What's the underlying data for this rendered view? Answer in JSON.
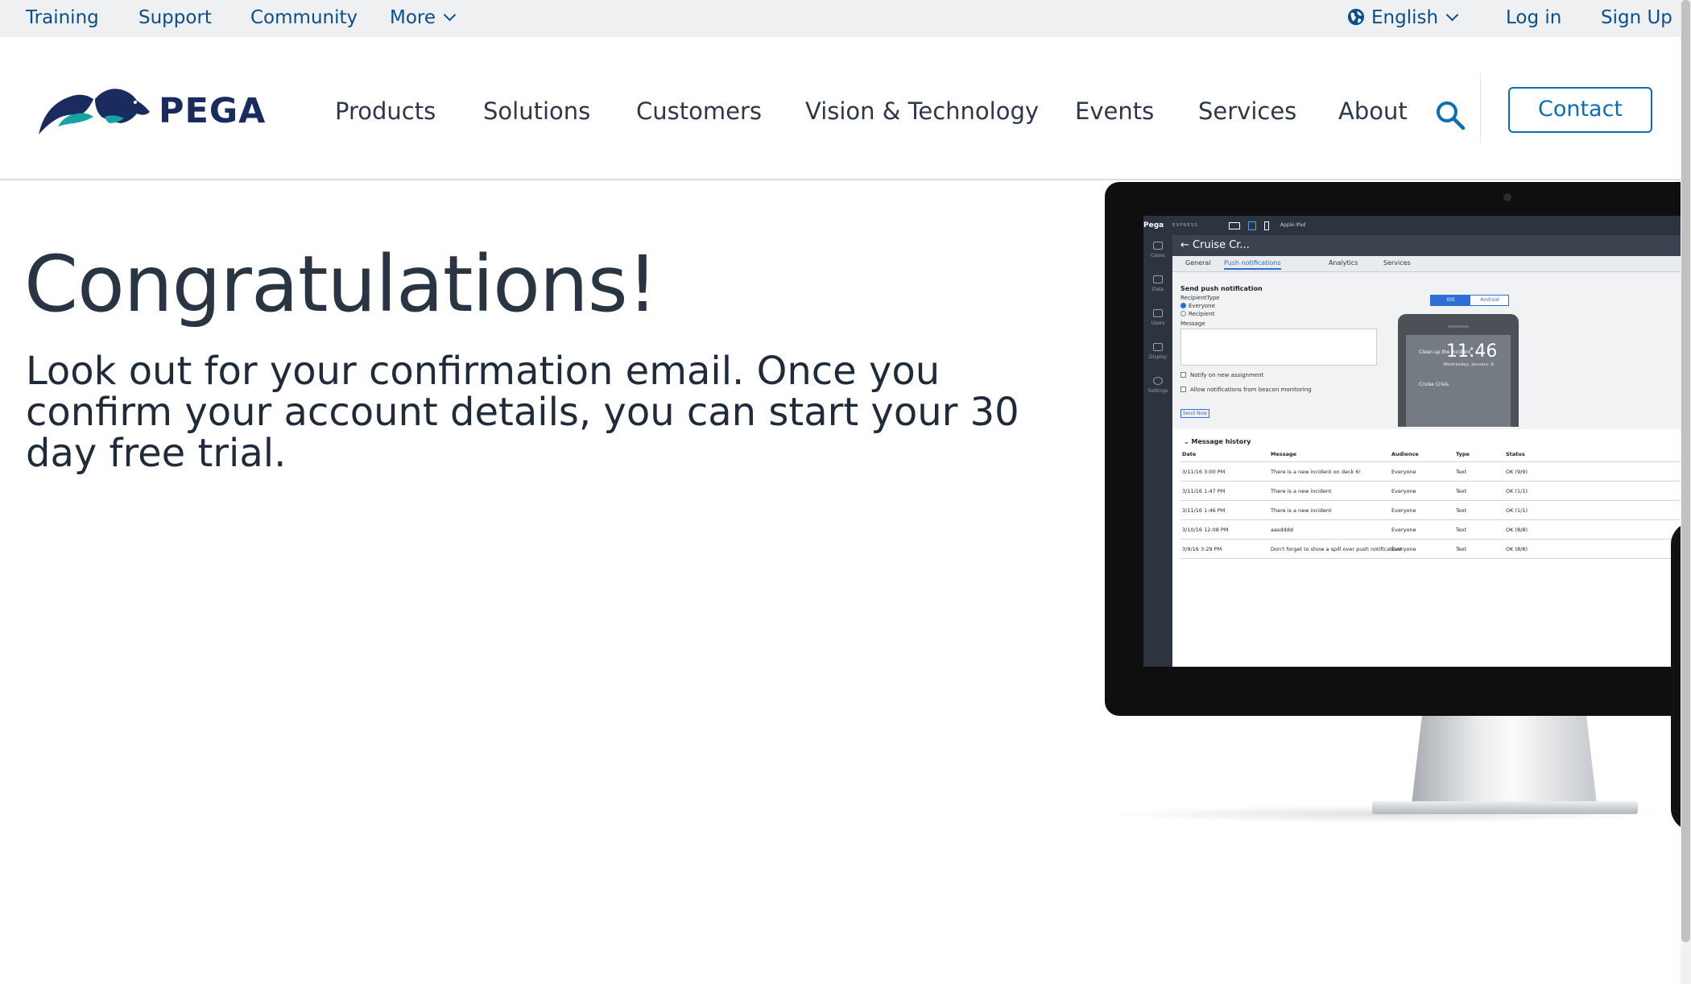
{
  "utility_bar": {
    "links": [
      "Training",
      "Support",
      "Community"
    ],
    "more_label": "More",
    "language": "English",
    "login": "Log in",
    "signup": "Sign Up"
  },
  "brand": {
    "name": "PEGA"
  },
  "nav": {
    "items": [
      "Products",
      "Solutions",
      "Customers",
      "Vision & Technology",
      "Events",
      "Services",
      "About"
    ],
    "contact_label": "Contact"
  },
  "hero": {
    "title": "Congratulations!",
    "body": "Look out for your confirmation email. Once you confirm your account details, you can start your 30 day free trial."
  },
  "device_screen": {
    "app_brand": "Pega",
    "app_brand_sub": "EXPRESS",
    "device_select": "Apple iPad",
    "page_title": "Cruise Cr...",
    "tabs": [
      "General",
      "Push notifications",
      "Analytics",
      "Services"
    ],
    "sidebar": [
      "Cases",
      "Data",
      "Users",
      "Display",
      "Settings"
    ],
    "form": {
      "heading": "Send push notification",
      "recipient_type": "RecipientType",
      "option_everyone": "Everyone",
      "option_recipient": "Recipient",
      "message_label": "Message",
      "notify_label": "Notify on new assignment",
      "beacon_label": "Allow notifications from beacon monitoring",
      "send_label": "Send Now",
      "ios": "iOS",
      "android": "Android"
    },
    "preview": {
      "time": "11:46",
      "date": "Wednesday, January, 6",
      "notification": "Clean up the incident",
      "crisis": "Cruise Crisis"
    },
    "history": {
      "title": "Message history",
      "columns": [
        "Date",
        "Message",
        "Audience",
        "Type",
        "Status"
      ],
      "rows": [
        [
          "3/11/16 3:00 PM",
          "There is a new incident on deck 6!",
          "Everyone",
          "Text",
          "OK (9/9)"
        ],
        [
          "3/11/16 1:47 PM",
          "There is a new incident",
          "Everyone",
          "Text",
          "OK (1/1)"
        ],
        [
          "3/11/16 1:46 PM",
          "There is a new incident",
          "Everyone",
          "Text",
          "OK (1/1)"
        ],
        [
          "3/10/16 12:08 PM",
          "aasdddd",
          "Everyone",
          "Text",
          "OK (8/8)"
        ],
        [
          "3/9/16 3:29 PM",
          "Don't forget to show a spill over push notification!",
          "Everyone",
          "Text",
          "OK (8/8)"
        ]
      ]
    }
  },
  "colors": {
    "link_blue": "#0a4f8c",
    "cta_blue": "#0a6eb6",
    "brand_navy": "#1a2b5f",
    "brand_teal": "#17a3a3",
    "utility_bg": "#eef0f2"
  }
}
